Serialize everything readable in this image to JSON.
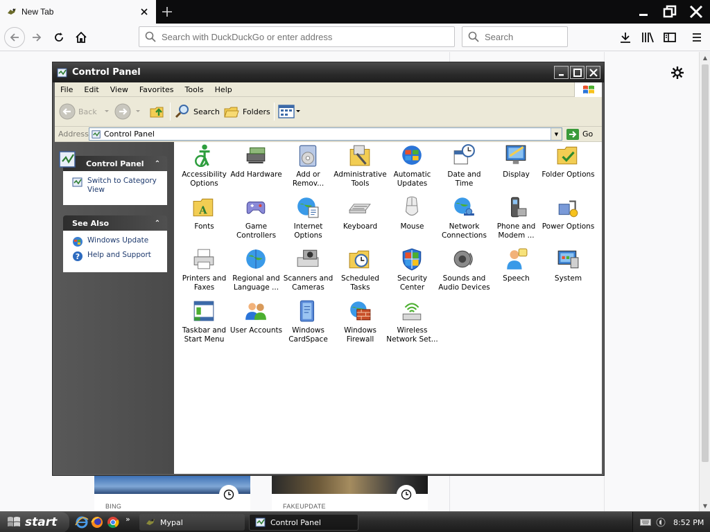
{
  "browser": {
    "tab_title": "New Tab",
    "url_placeholder": "Search with DuckDuckGo or enter address",
    "search_placeholder": "Search"
  },
  "page": {
    "tiles": [
      {
        "label": "BING"
      },
      {
        "label": "FAKEUPDATE"
      }
    ]
  },
  "window": {
    "title": "Control Panel",
    "menu": [
      "File",
      "Edit",
      "View",
      "Favorites",
      "Tools",
      "Help"
    ],
    "toolbar": {
      "back": "Back",
      "search": "Search",
      "folders": "Folders"
    },
    "address": {
      "label": "Address",
      "value": "Control Panel",
      "go": "Go"
    },
    "left": {
      "panel1_title": "Control Panel",
      "switch_view": "Switch to Category View",
      "panel2_title": "See Also",
      "windows_update": "Windows Update",
      "help_support": "Help and Support"
    },
    "icons": [
      {
        "label": "Accessibility Options",
        "icon": "accessibility-icon"
      },
      {
        "label": "Add Hardware",
        "icon": "add-hardware-icon"
      },
      {
        "label": "Add or Remov...",
        "icon": "add-remove-programs-icon"
      },
      {
        "label": "Administrative Tools",
        "icon": "administrative-tools-icon"
      },
      {
        "label": "Automatic Updates",
        "icon": "automatic-updates-icon"
      },
      {
        "label": "Date and Time",
        "icon": "date-time-icon"
      },
      {
        "label": "Display",
        "icon": "display-icon"
      },
      {
        "label": "Folder Options",
        "icon": "folder-options-icon"
      },
      {
        "label": "Fonts",
        "icon": "fonts-icon"
      },
      {
        "label": "Game Controllers",
        "icon": "game-controllers-icon"
      },
      {
        "label": "Internet Options",
        "icon": "internet-options-icon"
      },
      {
        "label": "Keyboard",
        "icon": "keyboard-icon"
      },
      {
        "label": "Mouse",
        "icon": "mouse-icon"
      },
      {
        "label": "Network Connections",
        "icon": "network-connections-icon"
      },
      {
        "label": "Phone and Modem ...",
        "icon": "phone-modem-icon"
      },
      {
        "label": "Power Options",
        "icon": "power-options-icon"
      },
      {
        "label": "Printers and Faxes",
        "icon": "printers-faxes-icon"
      },
      {
        "label": "Regional and Language ...",
        "icon": "regional-language-icon"
      },
      {
        "label": "Scanners and Cameras",
        "icon": "scanners-cameras-icon"
      },
      {
        "label": "Scheduled Tasks",
        "icon": "scheduled-tasks-icon"
      },
      {
        "label": "Security Center",
        "icon": "security-center-icon"
      },
      {
        "label": "Sounds and Audio Devices",
        "icon": "sounds-audio-icon"
      },
      {
        "label": "Speech",
        "icon": "speech-icon"
      },
      {
        "label": "System",
        "icon": "system-icon"
      },
      {
        "label": "Taskbar and Start Menu",
        "icon": "taskbar-start-menu-icon"
      },
      {
        "label": "User Accounts",
        "icon": "user-accounts-icon"
      },
      {
        "label": "Windows CardSpace",
        "icon": "windows-cardspace-icon"
      },
      {
        "label": "Windows Firewall",
        "icon": "windows-firewall-icon"
      },
      {
        "label": "Wireless Network Set...",
        "icon": "wireless-network-icon"
      }
    ]
  },
  "taskbar": {
    "start": "start",
    "tasks": [
      "Mypal",
      "Control Panel"
    ],
    "clock": "8:52 PM"
  }
}
